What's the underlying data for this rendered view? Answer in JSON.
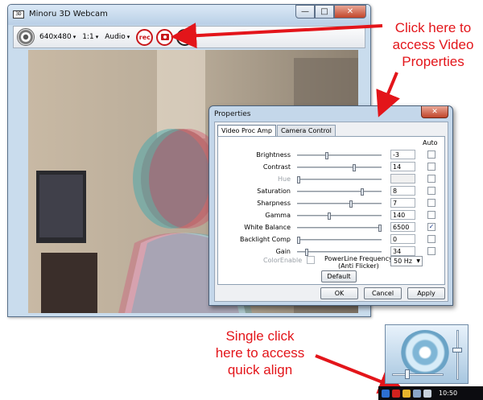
{
  "window": {
    "title": "Minoru 3D Webcam",
    "minimize": "—",
    "maximize": "□",
    "close": "✕"
  },
  "toolbar": {
    "resolution": "640x480",
    "zoom": "1:1",
    "audio": "Audio",
    "rec_label": "rec",
    "caret": "▾"
  },
  "dialog": {
    "title": "Properties",
    "close": "✕",
    "tabs": [
      "Video Proc Amp",
      "Camera Control"
    ],
    "auto_header": "Auto",
    "rows": [
      {
        "label": "Brightness",
        "value": "-3",
        "auto": false,
        "enabled": true,
        "pos": 0.35
      },
      {
        "label": "Contrast",
        "value": "14",
        "auto": false,
        "enabled": true,
        "pos": 0.68
      },
      {
        "label": "Hue",
        "value": "",
        "auto": false,
        "enabled": false,
        "pos": 0.0
      },
      {
        "label": "Saturation",
        "value": "8",
        "auto": false,
        "enabled": true,
        "pos": 0.78
      },
      {
        "label": "Sharpness",
        "value": "7",
        "auto": false,
        "enabled": true,
        "pos": 0.64
      },
      {
        "label": "Gamma",
        "value": "140",
        "auto": false,
        "enabled": true,
        "pos": 0.38
      },
      {
        "label": "White Balance",
        "value": "6500",
        "auto": true,
        "enabled": true,
        "pos": 1.0
      },
      {
        "label": "Backlight Comp",
        "value": "0",
        "auto": false,
        "enabled": true,
        "pos": 0.0
      },
      {
        "label": "Gain",
        "value": "34",
        "auto": false,
        "enabled": true,
        "pos": 0.1
      }
    ],
    "color_enable": "ColorEnable",
    "powerline_label_1": "PowerLine Frequency",
    "powerline_label_2": "(Anti Flicker)",
    "powerline_value": "50 Hz",
    "default_btn": "Default",
    "ok_btn": "OK",
    "cancel_btn": "Cancel",
    "apply_btn": "Apply"
  },
  "annotations": {
    "video_props": [
      "Click here to",
      "access Video",
      "Properties"
    ],
    "quick_align": [
      "Single click",
      "here to access",
      "quick align"
    ]
  },
  "taskbar": {
    "time": "10:50"
  },
  "colors": {
    "annotation_red": "#e3151a",
    "rec_red": "#c8171a"
  }
}
